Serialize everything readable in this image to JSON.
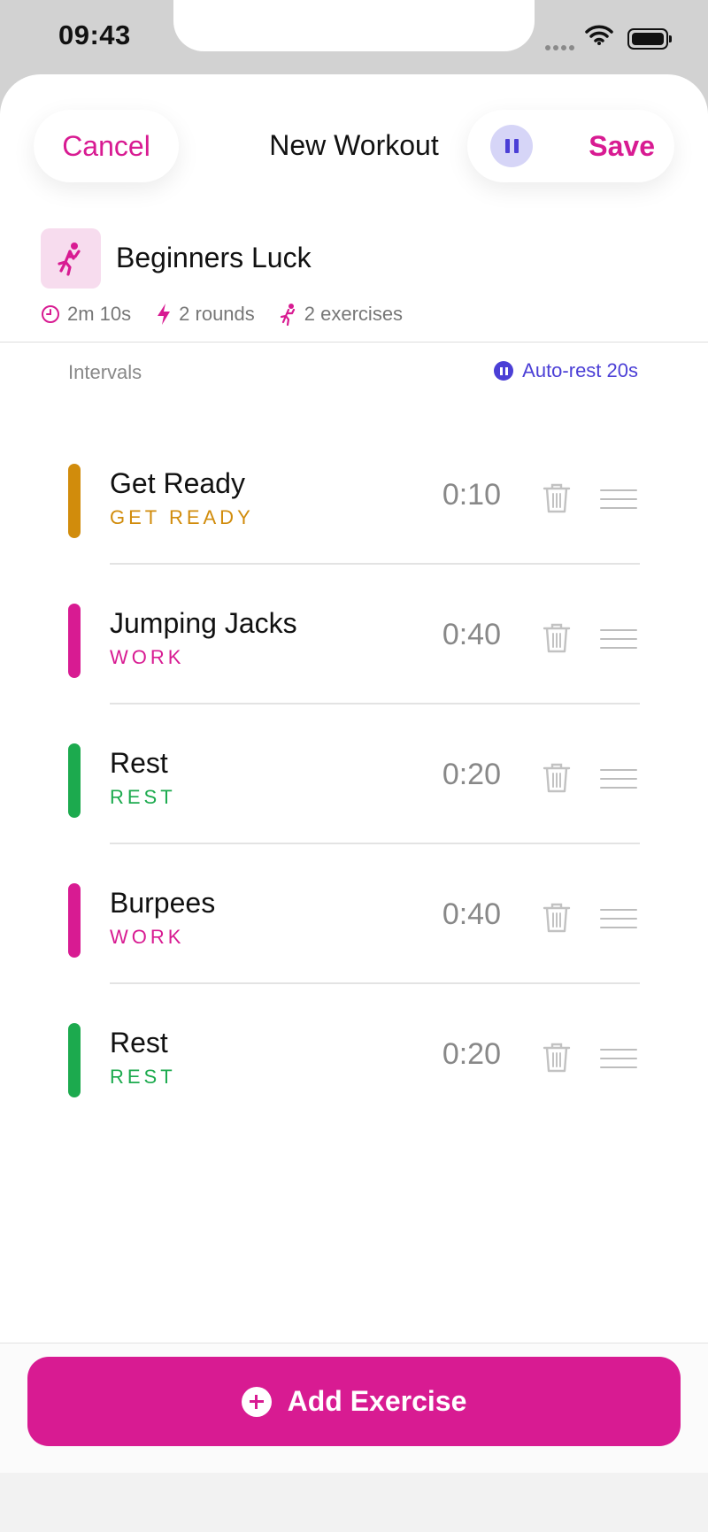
{
  "status_bar": {
    "time": "09:43"
  },
  "nav": {
    "cancel_label": "Cancel",
    "title": "New Workout",
    "save_label": "Save"
  },
  "workout": {
    "name": "Beginners Luck",
    "duration": "2m 10s",
    "rounds": "2 rounds",
    "exercises": "2 exercises"
  },
  "intervals_section": {
    "label": "Intervals",
    "auto_rest": "Auto-rest 20s"
  },
  "intervals": [
    {
      "name": "Get Ready",
      "kind": "GET READY",
      "duration": "0:10",
      "color": "#d18c0c"
    },
    {
      "name": "Jumping Jacks",
      "kind": "WORK",
      "duration": "0:40",
      "color": "#d81b92"
    },
    {
      "name": "Rest",
      "kind": "REST",
      "duration": "0:20",
      "color": "#1caa4e"
    },
    {
      "name": "Burpees",
      "kind": "WORK",
      "duration": "0:40",
      "color": "#d81b92"
    },
    {
      "name": "Rest",
      "kind": "REST",
      "duration": "0:20",
      "color": "#1caa4e"
    }
  ],
  "footer": {
    "add_label": "Add Exercise"
  },
  "colors": {
    "accent": "#d81b92",
    "auto_rest": "#4b3fd6"
  }
}
